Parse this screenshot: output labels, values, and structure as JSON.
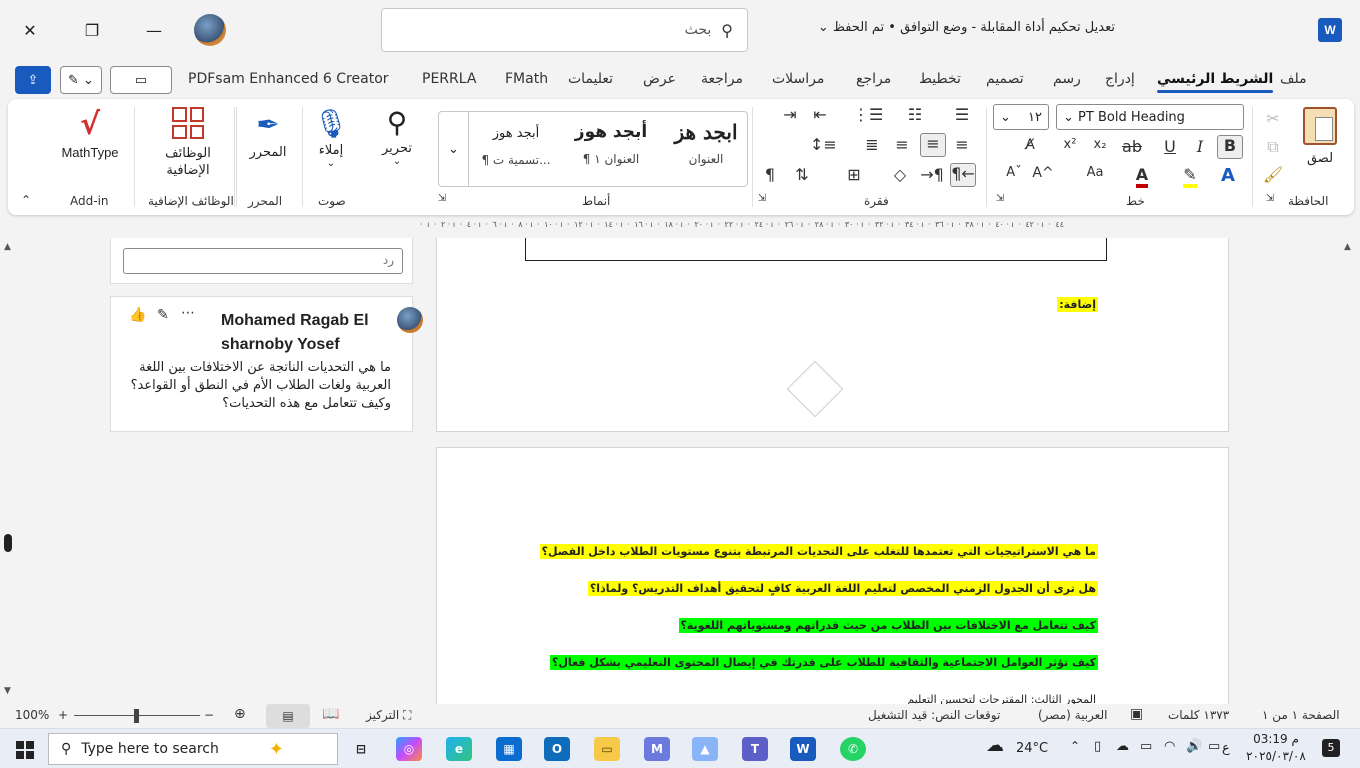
{
  "titlebar": {
    "doc_title": "تعديل تحكيم أداة المقابلة  -  وضع التوافق • تم الحفظ",
    "search_placeholder": "بحث",
    "app_letter": "W"
  },
  "tabs": [
    "ملف",
    "الشريط الرئيسي",
    "إدراج",
    "رسم",
    "تصميم",
    "تخطيط",
    "مراجع",
    "مراسلات",
    "مراجعة",
    "عرض",
    "تعليمات",
    "FMath",
    "PERRLA",
    "PDFsam Enhanced 6 Creator"
  ],
  "ribbon": {
    "clipboard": {
      "paste": "لصق",
      "label": "الحافظة"
    },
    "font": {
      "name": "PT Bold Heading",
      "size": "١٢",
      "bold": "B",
      "italic": "I",
      "underline": "U",
      "strike": "ab",
      "sub": "x₂",
      "sup": "x²",
      "grow": "A^",
      "shrink": "Aˇ",
      "case": "Aa",
      "label": "خط"
    },
    "paragraph": {
      "label": "فقرة"
    },
    "styles": {
      "items": [
        {
          "preview": "ابجد هز",
          "name": "العنوان"
        },
        {
          "preview": "أبجد هوز",
          "name": "¶ العنوان ١"
        },
        {
          "preview": "أبجد هوز",
          "name": "¶ تسمية ت..."
        }
      ],
      "label": "أنماط"
    },
    "editing": {
      "name": "تحرير"
    },
    "voice": {
      "name": "إملاء",
      "label": "صوت"
    },
    "editor": {
      "name": "المحرر",
      "label": "المحرر"
    },
    "addins": {
      "name": "الوظائف الإضافية",
      "label": "الوظائف الإضافية"
    },
    "mathtype": {
      "name": "MathType",
      "label": "Add-in"
    }
  },
  "ruler_text": "· ı · ٢ · ı · ٤ · ı · ٦ · ı · ٨ · ı · ١٠ · ı · ١٢ · ı · ١٤ · ı · ١٦ · ı · ١٨ · ı · ٢٠ · ı · ٢٢ · ı · ٢٤ · ı · ٢٦ · ı · ٢٨ · ı · ٣٠ · ı · ٣٢ · ı · ٣٤ · ı · ٣٦ · ı · ٣٨ · ı · ٤٠ · ı · ٤٢ · ı · ٤٤",
  "comments": {
    "reply_placeholder": "رد",
    "author": "Mohamed Ragab El sharnoby Yosef",
    "text": "ما هي التحديات الناتجة عن الاختلافات بين اللغة العربية ولغات الطلاب الأم في النطق أو القواعد؟ وكيف تتعامل مع هذه التحديات؟"
  },
  "document": {
    "addition": "إضافة:",
    "questions": [
      {
        "text": "ما هي الاستراتيجيات التي تعتمدها للتغلب على التحديات المرتبطة بتنوع مستويات الطلاب داخل الفصل؟",
        "color": "#ffff00"
      },
      {
        "text": "هل ترى أن الجدول الزمني المخصص لتعليم اللغة العربية كافٍ لتحقيق أهداف التدريس؟ ولماذا؟",
        "color": "#ffff00"
      },
      {
        "text": "كيف تتعامل مع الاختلافات بين الطلاب من حيث قدراتهم ومستوياتهم اللغوية؟",
        "color": "#00ff00"
      },
      {
        "text": "كيف تؤثر العوامل الاجتماعية والثقافية للطلاب على قدرتك في إيصال المحتوى التعليمي بشكل فعال؟",
        "color": "#00ff00"
      }
    ],
    "cut_line": "المحور الثالث: المقترحات لتحسين التعليم"
  },
  "statusbar": {
    "page": "الصفحة ١ من ١",
    "words": "١٣٧٣ كلمات",
    "language": "العربية (مصر)",
    "predictions": "توقعات النص: قيد التشغيل",
    "focus": "التركيز",
    "zoom": "100%"
  },
  "taskbar": {
    "search_placeholder": "Type here to search",
    "temp": "24°C",
    "time": "03:19 م",
    "date": "٢٠٢٥/٠٣/٠٨",
    "lang": "ع",
    "notif": "5"
  },
  "colors": {
    "accent": "#185abd",
    "yellow_hl": "#ffff00",
    "green_hl": "#00ff00"
  }
}
